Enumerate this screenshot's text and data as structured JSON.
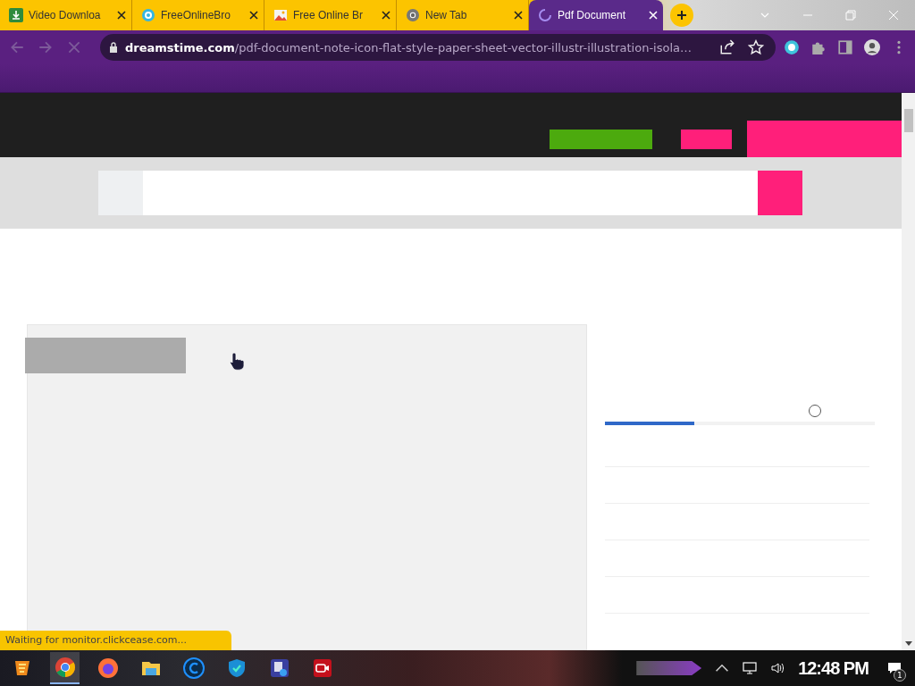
{
  "tabs": [
    {
      "title": "Video Downloa",
      "kind": "download",
      "selected": false,
      "loading": false
    },
    {
      "title": "FreeOnlineBro",
      "kind": "ring",
      "selected": false,
      "loading": false
    },
    {
      "title": "Free Online Br",
      "kind": "photo",
      "selected": false,
      "loading": false
    },
    {
      "title": "New Tab",
      "kind": "chrome",
      "selected": false,
      "loading": false
    },
    {
      "title": "Pdf Document",
      "selected": true,
      "loading": true
    }
  ],
  "address": {
    "host": "dreamstime.com",
    "path": "/pdf-document-note-icon-flat-style-paper-sheet-vector-illustr-illustration-isola…"
  },
  "page": {
    "level": 0.33,
    "option_checked": false
  },
  "status_text": "Waiting for monitor.clickcease.com...",
  "taskbar": {
    "apps": [
      {
        "kind": "game",
        "selected": false
      },
      {
        "kind": "chrome",
        "selected": true
      },
      {
        "kind": "firefox",
        "selected": false
      },
      {
        "kind": "folder",
        "selected": false
      },
      {
        "kind": "c",
        "selected": false
      },
      {
        "kind": "shield",
        "selected": false
      },
      {
        "kind": "app",
        "selected": false
      },
      {
        "kind": "camera",
        "selected": false
      }
    ],
    "clock": "12:48 PM",
    "notification_count": "1"
  }
}
